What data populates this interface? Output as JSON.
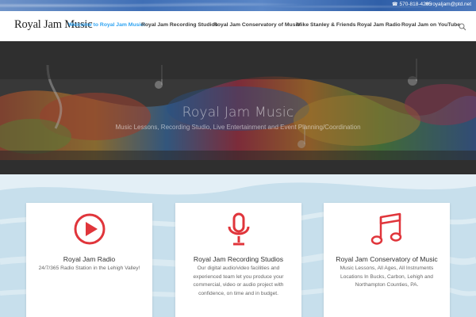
{
  "topbar": {
    "phone": "570-818-4205",
    "email": "royaljam@ptd.net",
    "phone_icon": "phone-icon",
    "email_icon": "envelope-icon"
  },
  "header": {
    "logo": "Royal Jam Music",
    "nav": [
      {
        "label": "Welcome to Royal Jam Music!",
        "active": true
      },
      {
        "label": "Royal Jam Recording Studios",
        "active": false
      },
      {
        "label": "Royal Jam Conservatory of Music",
        "active": false
      },
      {
        "label": "Mike Stanley & Friends",
        "active": false
      },
      {
        "label": "Royal Jam Radio",
        "active": false
      },
      {
        "label": "Royal Jam on YouTube",
        "active": false
      }
    ],
    "search_icon": "search-icon"
  },
  "hero": {
    "title": "Royal Jam Music",
    "subtitle": "Music Lessons, Recording Studio, Live Entertainment and Event Planning/Coordination"
  },
  "features": [
    {
      "icon": "play-circle-icon",
      "title": "Royal Jam Radio",
      "description": "24/7/365 Radio Station in the Lehigh Valley!"
    },
    {
      "icon": "microphone-icon",
      "title": "Royal Jam Recording Studios",
      "description": "Our digital audio/video facilities and experienced team let you produce your commercial, video or audio project with confidence, on time and in budget."
    },
    {
      "icon": "music-note-icon",
      "title": "Royal Jam Conservatory of Music",
      "description": "Music Lessons, All Ages, All Instruments Locations In Bucks, Carbon, Lehigh and Northampton Counties, PA."
    }
  ],
  "colors": {
    "accent": "#2ea3f2",
    "icon_red": "#e0353b",
    "nav_text": "#3b3b3b"
  }
}
